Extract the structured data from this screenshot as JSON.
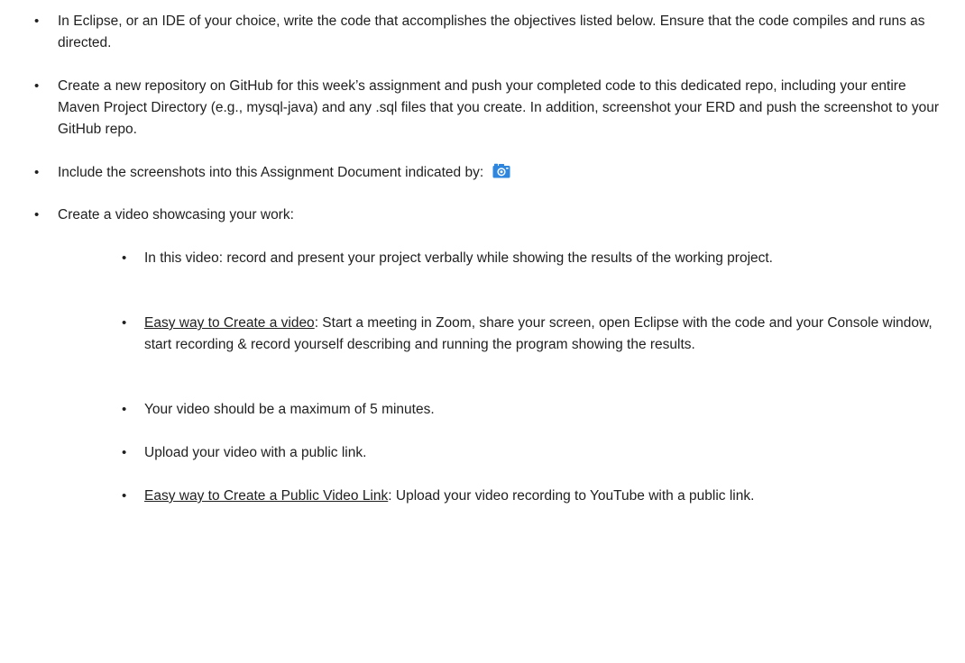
{
  "bullets": {
    "symbol": "•"
  },
  "items": [
    {
      "text": "In Eclipse, or an IDE of your choice, write the code that accomplishes the objectives listed below. Ensure that the code compiles and runs as directed."
    },
    {
      "text": "Create a new repository on GitHub for this week’s assignment and push your completed code to this dedicated repo, including your entire Maven Project Directory (e.g., mysql-java) and any .sql files that you create.  In addition, screenshot your ERD and push the screenshot to your GitHub repo."
    },
    {
      "text": "Include the screenshots into this Assignment Document indicated by:",
      "icon": "camera-icon",
      "icon_color": "#2e86de"
    },
    {
      "text": "Create a video showcasing your work:"
    }
  ],
  "subitems": [
    {
      "text": "In this video: record and present your project verbally while showing the results of the working project."
    },
    {
      "label": "Easy way to Create a video",
      "text": ":  Start a meeting in Zoom, share your screen, open Eclipse with the code and your Console window, start recording & record yourself describing and running the program showing the results."
    },
    {
      "text": "Your video should be a maximum of 5 minutes."
    },
    {
      "text": "Upload your video with a public link."
    },
    {
      "label": "Easy way to Create a Public Video Link",
      "text": ":  Upload your video recording to YouTube with a public link."
    }
  ]
}
